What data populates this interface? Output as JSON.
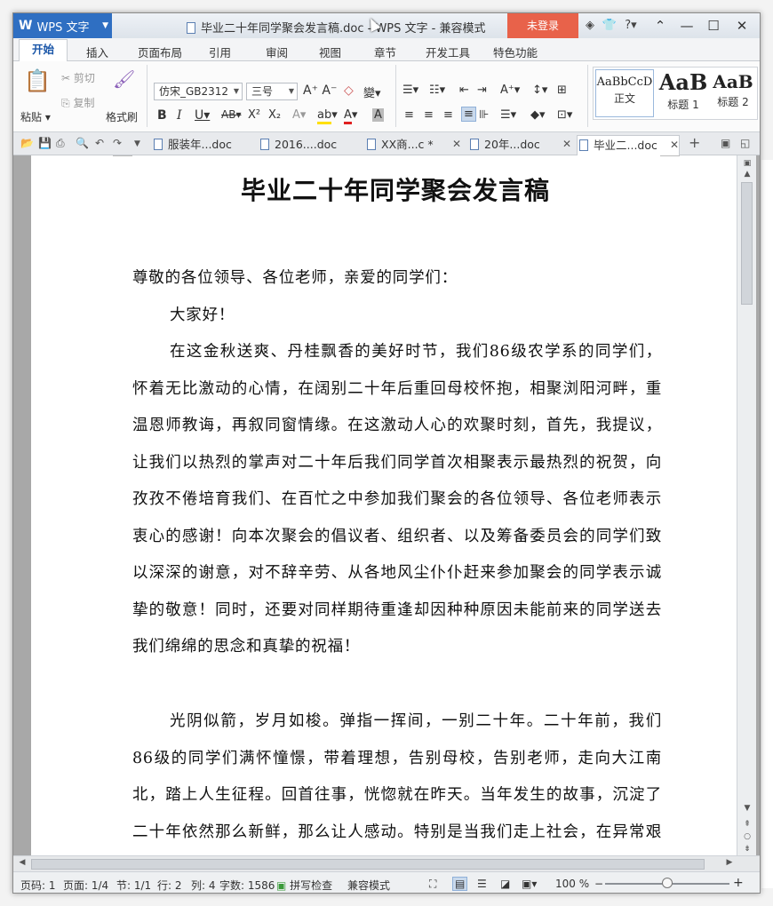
{
  "app": {
    "name": "WPS 文字",
    "window_title": "毕业二十年同学聚会发言稿.doc - WPS 文字 - 兼容模式",
    "login_label": "未登录"
  },
  "menu": [
    "开始",
    "插入",
    "页面布局",
    "引用",
    "审阅",
    "视图",
    "章节",
    "开发工具",
    "特色功能"
  ],
  "ribbon": {
    "paste": "粘贴",
    "cut": "剪切",
    "copy": "复制",
    "format_painter": "格式刷",
    "font_name": "仿宋_GB2312",
    "font_size": "三号",
    "styles": [
      {
        "preview": "AaBbCcD",
        "name": "正文"
      },
      {
        "preview": "AaB",
        "name": "标题 1"
      },
      {
        "preview": "AaB",
        "name": "标题 2"
      }
    ]
  },
  "tabs": [
    {
      "label": "服装年...doc",
      "active": false
    },
    {
      "label": "2016....doc",
      "active": false
    },
    {
      "label": "XX商...c *",
      "active": false
    },
    {
      "label": "20年...doc",
      "active": false
    },
    {
      "label": "毕业二...doc",
      "active": true
    }
  ],
  "document": {
    "title": "毕业二十年同学聚会发言稿",
    "greeting": "尊敬的各位领导、各位老师，亲爱的同学们：",
    "hello": "大家好！",
    "p1": "在这金秋送爽、丹桂飘香的美好时节，我们86级农学系的同学们，怀着无比激动的心情，在阔别二十年后重回母校怀抱，相聚浏阳河畔，重温恩师教诲，再叙同窗情缘。在这激动人心的欢聚时刻，首先，我提议，让我们以热烈的掌声对二十年后我们同学首次相聚表示最热烈的祝贺，向孜孜不倦培育我们、在百忙之中参加我们聚会的各位领导、各位老师表示衷心的感谢！向本次聚会的倡议者、组织者、以及筹备委员会的同学们致以深深的谢意，对不辞辛劳、从各地风尘仆仆赶来参加聚会的同学表示诚挚的敬意！同时，还要对同样期待重逢却因种种原因未能前来的同学送去我们绵绵的思念和真挚的祝福！",
    "p2": "光阴似箭，岁月如梭。弹指一挥间，一别二十年。二十年前，我们86级的同学们满怀憧憬，带着理想，告别母校，告别老师，走向大江南北，踏上人生征程。回首往事，恍惚就在昨天。当年发生的故事，沉淀了二十年依然那么新鲜，那么让人感动。特别是当我们走上社会，在异常艰辛的奋斗旅途，经历了世事的浮"
  },
  "status": {
    "page_code": "页码: 1",
    "pages": "页面: 1/4",
    "section": "节: 1/1",
    "row": "行: 2",
    "col": "列: 4",
    "word_count": "字数: 1586",
    "spell_check": "拼写检查",
    "compat": "兼容模式",
    "zoom": "100 %"
  }
}
